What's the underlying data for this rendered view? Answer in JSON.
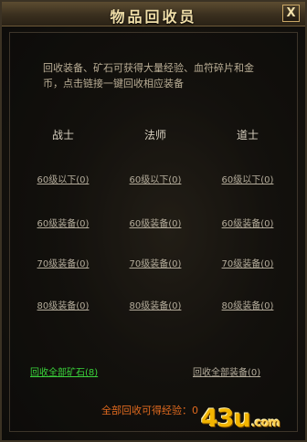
{
  "window": {
    "title": "物品回收员",
    "close_label": "X"
  },
  "description": "回收装备、矿石可获得大量经验、血符碎片和金币，点击链接一键回收相应装备",
  "columns": [
    "战士",
    "法师",
    "道士"
  ],
  "rows": [
    [
      "60级以下(0)",
      "60级以下(0)",
      "60级以下(0)"
    ],
    [
      "60级装备(0)",
      "60级装备(0)",
      "60级装备(0)"
    ],
    [
      "70级装备(0)",
      "70级装备(0)",
      "70级装备(0)"
    ],
    [
      "80级装备(0)",
      "80级装备(0)",
      "80级装备(0)"
    ]
  ],
  "actions": {
    "recycle_ore": "回收全部矿石(8)",
    "recycle_equip": "回收全部装备(0)"
  },
  "exp_label": "全部回收可得经验：0",
  "watermark": {
    "main": "43u",
    "suffix": ".com"
  },
  "colors": {
    "title": "#f1dfa9",
    "ore_link": "#3bd43b",
    "exp_text": "#e06a1f"
  }
}
